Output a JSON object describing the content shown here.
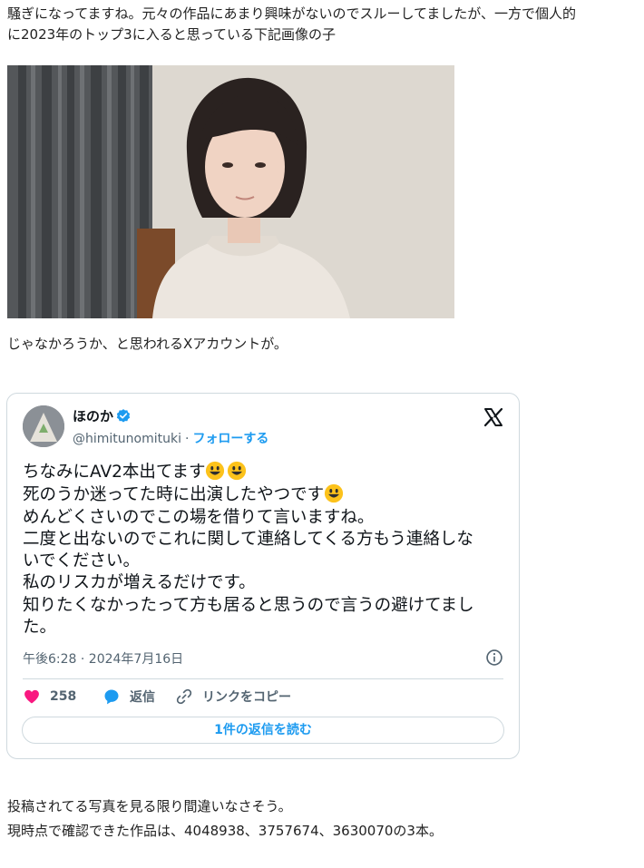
{
  "article": {
    "intro_line1": "騒ぎになってますね。元々の作品にあまり興味がないのでスルーしてましたが、一方で個人的",
    "intro_line2": "に2023年のトップ3に入ると思っている下記画像の子",
    "after_photo": "じゃなかろうか、と思われるXアカウントが。",
    "outro_line1": "投稿されてる写真を見る限り間違いなさそう。",
    "outro_line2": "現時点で確認できた作品は、4048938、3757674、3630070の3本。"
  },
  "post": {
    "display_name": "ほのか",
    "handle": "@himitunomituki",
    "separator": "·",
    "follow_label": "フォローする",
    "lines": [
      "ちなみにAV2本出てます",
      "死のうか迷ってた時に出演したやつです",
      "めんどくさいのでこの場を借りて言いますね。",
      "二度と出ないのでこれに関して連絡してくる方もう連絡しな",
      "いでください。",
      "私のリスカが増えるだけです。",
      "知りたくなかったって方も居ると思うので言うの避けてまし",
      "た。"
    ],
    "timestamp": "午後6:28 · 2024年7月16日",
    "like_count": "258",
    "reply_label": "返信",
    "copy_link_label": "リンクをコピー",
    "read_replies_label": "1件の返信を読む"
  },
  "colors": {
    "accent": "#1d9bf0",
    "like": "#f91880",
    "muted_text": "#536471",
    "border": "#cfd9de"
  },
  "icons": [
    "verified-badge-icon",
    "x-logo-icon",
    "info-icon",
    "heart-icon",
    "reply-bubble-icon",
    "link-icon",
    "smiley-emoji-icon"
  ]
}
